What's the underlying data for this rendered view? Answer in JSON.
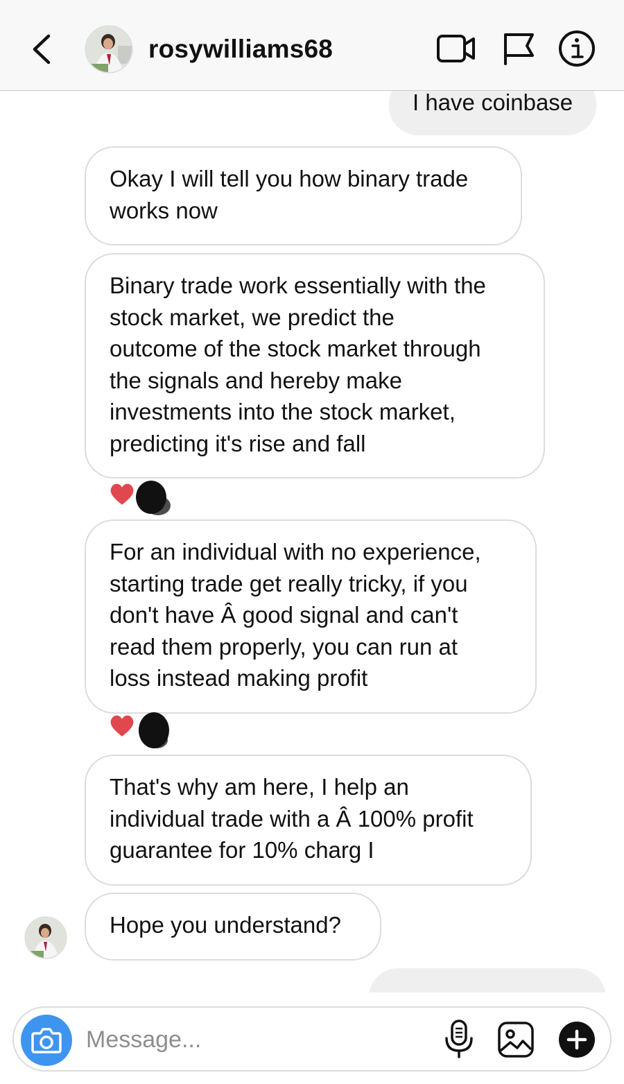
{
  "header": {
    "username": "rosywilliams68",
    "back_icon": "chevron-left-icon",
    "video_icon": "video-camera-icon",
    "flag_icon": "flag-icon",
    "info_icon": "info-icon"
  },
  "messages": [
    {
      "sender": "me",
      "lines": [
        "I have coinbase"
      ]
    },
    {
      "sender": "them",
      "lines": [
        "Okay I will tell you how binary trade",
        "works now"
      ]
    },
    {
      "sender": "them",
      "lines": [
        "Binary trade work essentially with the",
        "stock market, we predict the",
        "outcome of the stock market through",
        "the signals and hereby make",
        "investments into the stock market,",
        "predicting it's rise and fall"
      ],
      "reaction": "heart"
    },
    {
      "sender": "them",
      "lines": [
        "For an individual with no experience,",
        "starting trade get really tricky, if you",
        "don't have Â good signal and can't",
        "read them properly, you can run at",
        "loss instead making profit"
      ],
      "reaction": "heart"
    },
    {
      "sender": "them",
      "lines": [
        "That's why am here, I help an",
        "individual trade with a Â 100% profit",
        "guarantee for 10% charg I"
      ]
    },
    {
      "sender": "them",
      "lines": [
        "Hope you understand?"
      ]
    }
  ],
  "composer": {
    "placeholder": "Message...",
    "camera_icon": "camera-icon",
    "mic_icon": "microphone-icon",
    "gallery_icon": "image-gallery-icon",
    "plus_icon": "plus-circle-icon"
  },
  "colors": {
    "accent_blue": "#3d95ef",
    "reaction_red": "#e0474f",
    "incoming_border": "#dcdcdc",
    "outgoing_bg": "#efefef"
  }
}
